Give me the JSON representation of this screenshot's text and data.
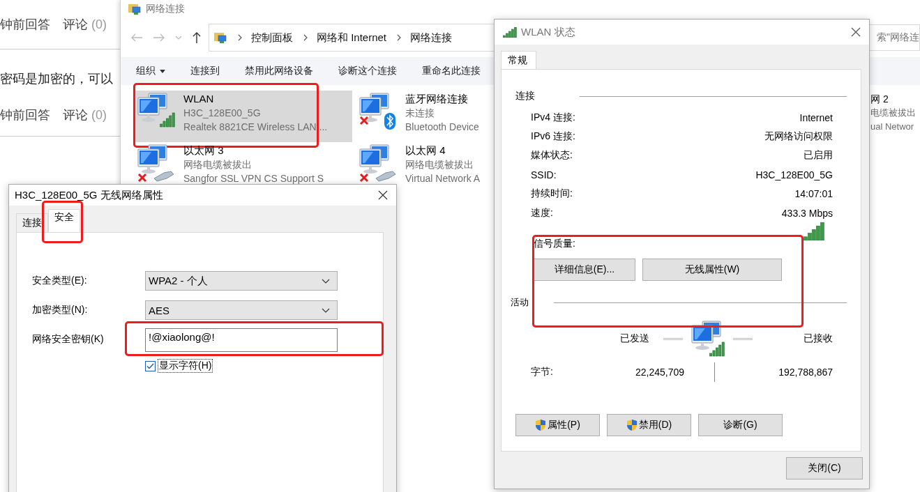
{
  "web_page": {
    "rows": [
      {
        "kind": "meta",
        "answer": "钟前回答",
        "comments": "评论",
        "count": "(0)"
      },
      {
        "kind": "text",
        "text": "密码是加密的，可以"
      },
      {
        "kind": "meta",
        "answer": "钟前回答",
        "comments": "评论",
        "count": "(0)"
      }
    ]
  },
  "explorer": {
    "title": "网络连接",
    "breadcrumb": [
      "控制面板",
      "网络和 Internet",
      "网络连接"
    ],
    "search": {
      "placeholder": "索\"网络连"
    },
    "toolbar": [
      {
        "label": "组织",
        "dropdown": true
      },
      {
        "label": "连接到",
        "dropdown": false
      },
      {
        "label": "禁用此网络设备",
        "dropdown": false
      },
      {
        "label": "诊断这个连接",
        "dropdown": false
      },
      {
        "label": "重命名此连接",
        "dropdown": false
      }
    ],
    "items": [
      {
        "name": "WLAN",
        "status": "H3C_128E00_5G",
        "device": "Realtek 8821CE Wireless LAN ...",
        "kind": "wireless",
        "selected": true,
        "highlighted": true
      },
      {
        "name": "以太网 3",
        "status": "网络电缆被拔出",
        "device": "Sangfor SSL VPN CS Support S",
        "kind": "cable",
        "selected": false,
        "highlighted": false
      },
      {
        "name": "蓝牙网络连接",
        "status": "未连接",
        "device": "Bluetooth Device",
        "kind": "bluetooth",
        "selected": false,
        "highlighted": false
      },
      {
        "name": "以太网 4",
        "status": "网络电缆被拔出",
        "device": "Virtual Network A",
        "kind": "cable",
        "selected": false,
        "highlighted": false
      },
      {
        "name": "网 2",
        "status": "电缆被拔出",
        "device": "ual Networ",
        "kind": "text_only",
        "selected": false,
        "highlighted": false
      }
    ]
  },
  "properties_dialog": {
    "title": "H3C_128E00_5G 无线网络属性",
    "tabs": [
      {
        "label": "连接",
        "selected": false,
        "highlighted": false
      },
      {
        "label": "安全",
        "selected": true,
        "highlighted": true
      }
    ],
    "fields": [
      {
        "kind": "select",
        "label": "安全类型(E):",
        "value": "WPA2 - 个人",
        "highlighted": false
      },
      {
        "kind": "select",
        "label": "加密类型(N):",
        "value": "AES",
        "highlighted": false
      },
      {
        "kind": "text",
        "label": "网络安全密钥(K)",
        "value": "!@xiaolong@!",
        "highlighted": true
      }
    ],
    "show_chars": {
      "label": "显示字符(H)",
      "checked": true
    }
  },
  "status_dialog": {
    "title": "WLAN 状态",
    "tabs": [
      {
        "label": "常规",
        "selected": true
      }
    ],
    "connection": {
      "heading": "连接",
      "rows": [
        {
          "label": "IPv4 连接:",
          "value": "Internet"
        },
        {
          "label": "IPv6 连接:",
          "value": "无网络访问权限"
        },
        {
          "label": "媒体状态:",
          "value": "已启用"
        },
        {
          "label": "SSID:",
          "value": "H3C_128E00_5G"
        },
        {
          "label": "持续时间:",
          "value": "14:07:01"
        },
        {
          "label": "速度:",
          "value": "433.3 Mbps"
        }
      ]
    },
    "signal": {
      "label": "信号质量:",
      "highlighted": true
    },
    "detail_buttons": [
      "详细信息(E)...",
      "无线属性(W)"
    ],
    "activity": {
      "heading": "活动",
      "sent_label": "已发送",
      "received_label": "已接收",
      "bytes_label": "字节:",
      "sent": "22,245,709",
      "received": "192,788,867"
    },
    "buttons": [
      {
        "label": "属性(P)",
        "shield": true
      },
      {
        "label": "禁用(D)",
        "shield": true
      },
      {
        "label": "诊断(G)",
        "shield": false
      }
    ],
    "close": "关闭(C)"
  }
}
